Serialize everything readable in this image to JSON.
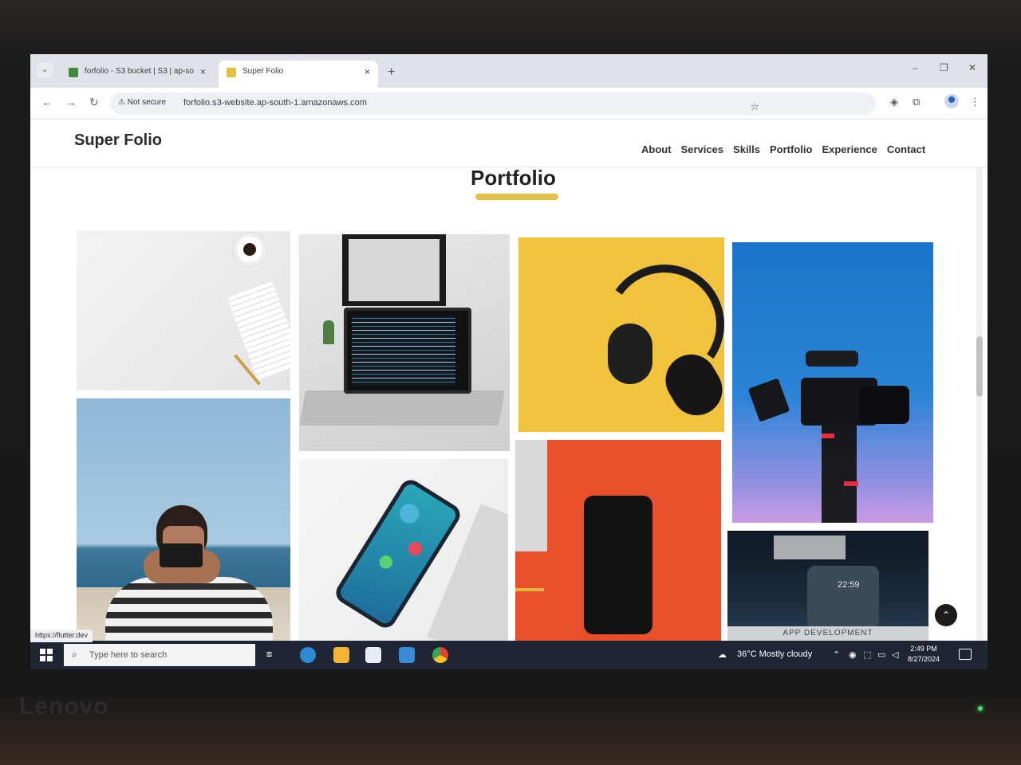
{
  "browser": {
    "tabs": [
      {
        "title": "forfolio - S3 bucket | S3 | ap-so",
        "close": "×"
      },
      {
        "title": "Super Folio",
        "close": "×"
      }
    ],
    "new_tab": "+",
    "tab_list": "⌄",
    "window_controls": {
      "minimize": "–",
      "restore": "❐",
      "close": "✕"
    },
    "nav": {
      "back": "←",
      "forward": "→",
      "reload": "↻"
    },
    "security_label": "Not secure",
    "url": "forfolio.s3-website.ap-south-1.amazonaws.com",
    "bookmark": "☆",
    "status_url": "https://flutter.dev"
  },
  "site": {
    "logo": "Super Folio",
    "nav": [
      "About",
      "Services",
      "Skills",
      "Portfolio",
      "Experience",
      "Contact"
    ],
    "section_title": "Portfolio",
    "accent_color": "#e3c24a",
    "tiles": [
      {
        "subject": "desk with coffee"
      },
      {
        "subject": "laptop with code"
      },
      {
        "subject": "headphones"
      },
      {
        "subject": "video camera"
      },
      {
        "subject": "photographer on beach"
      },
      {
        "subject": "smartphone"
      },
      {
        "subject": "black phone"
      },
      {
        "subject": "app development",
        "caption": "APP DEVELOPMENT",
        "clock": "22:59"
      }
    ],
    "back_to_top": "⌃"
  },
  "taskbar": {
    "search_placeholder": "Type here to search",
    "weather": "36°C  Mostly cloudy",
    "time": "2:49 PM",
    "date": "8/27/2024"
  },
  "monitor": {
    "brand": "Lenovo"
  }
}
